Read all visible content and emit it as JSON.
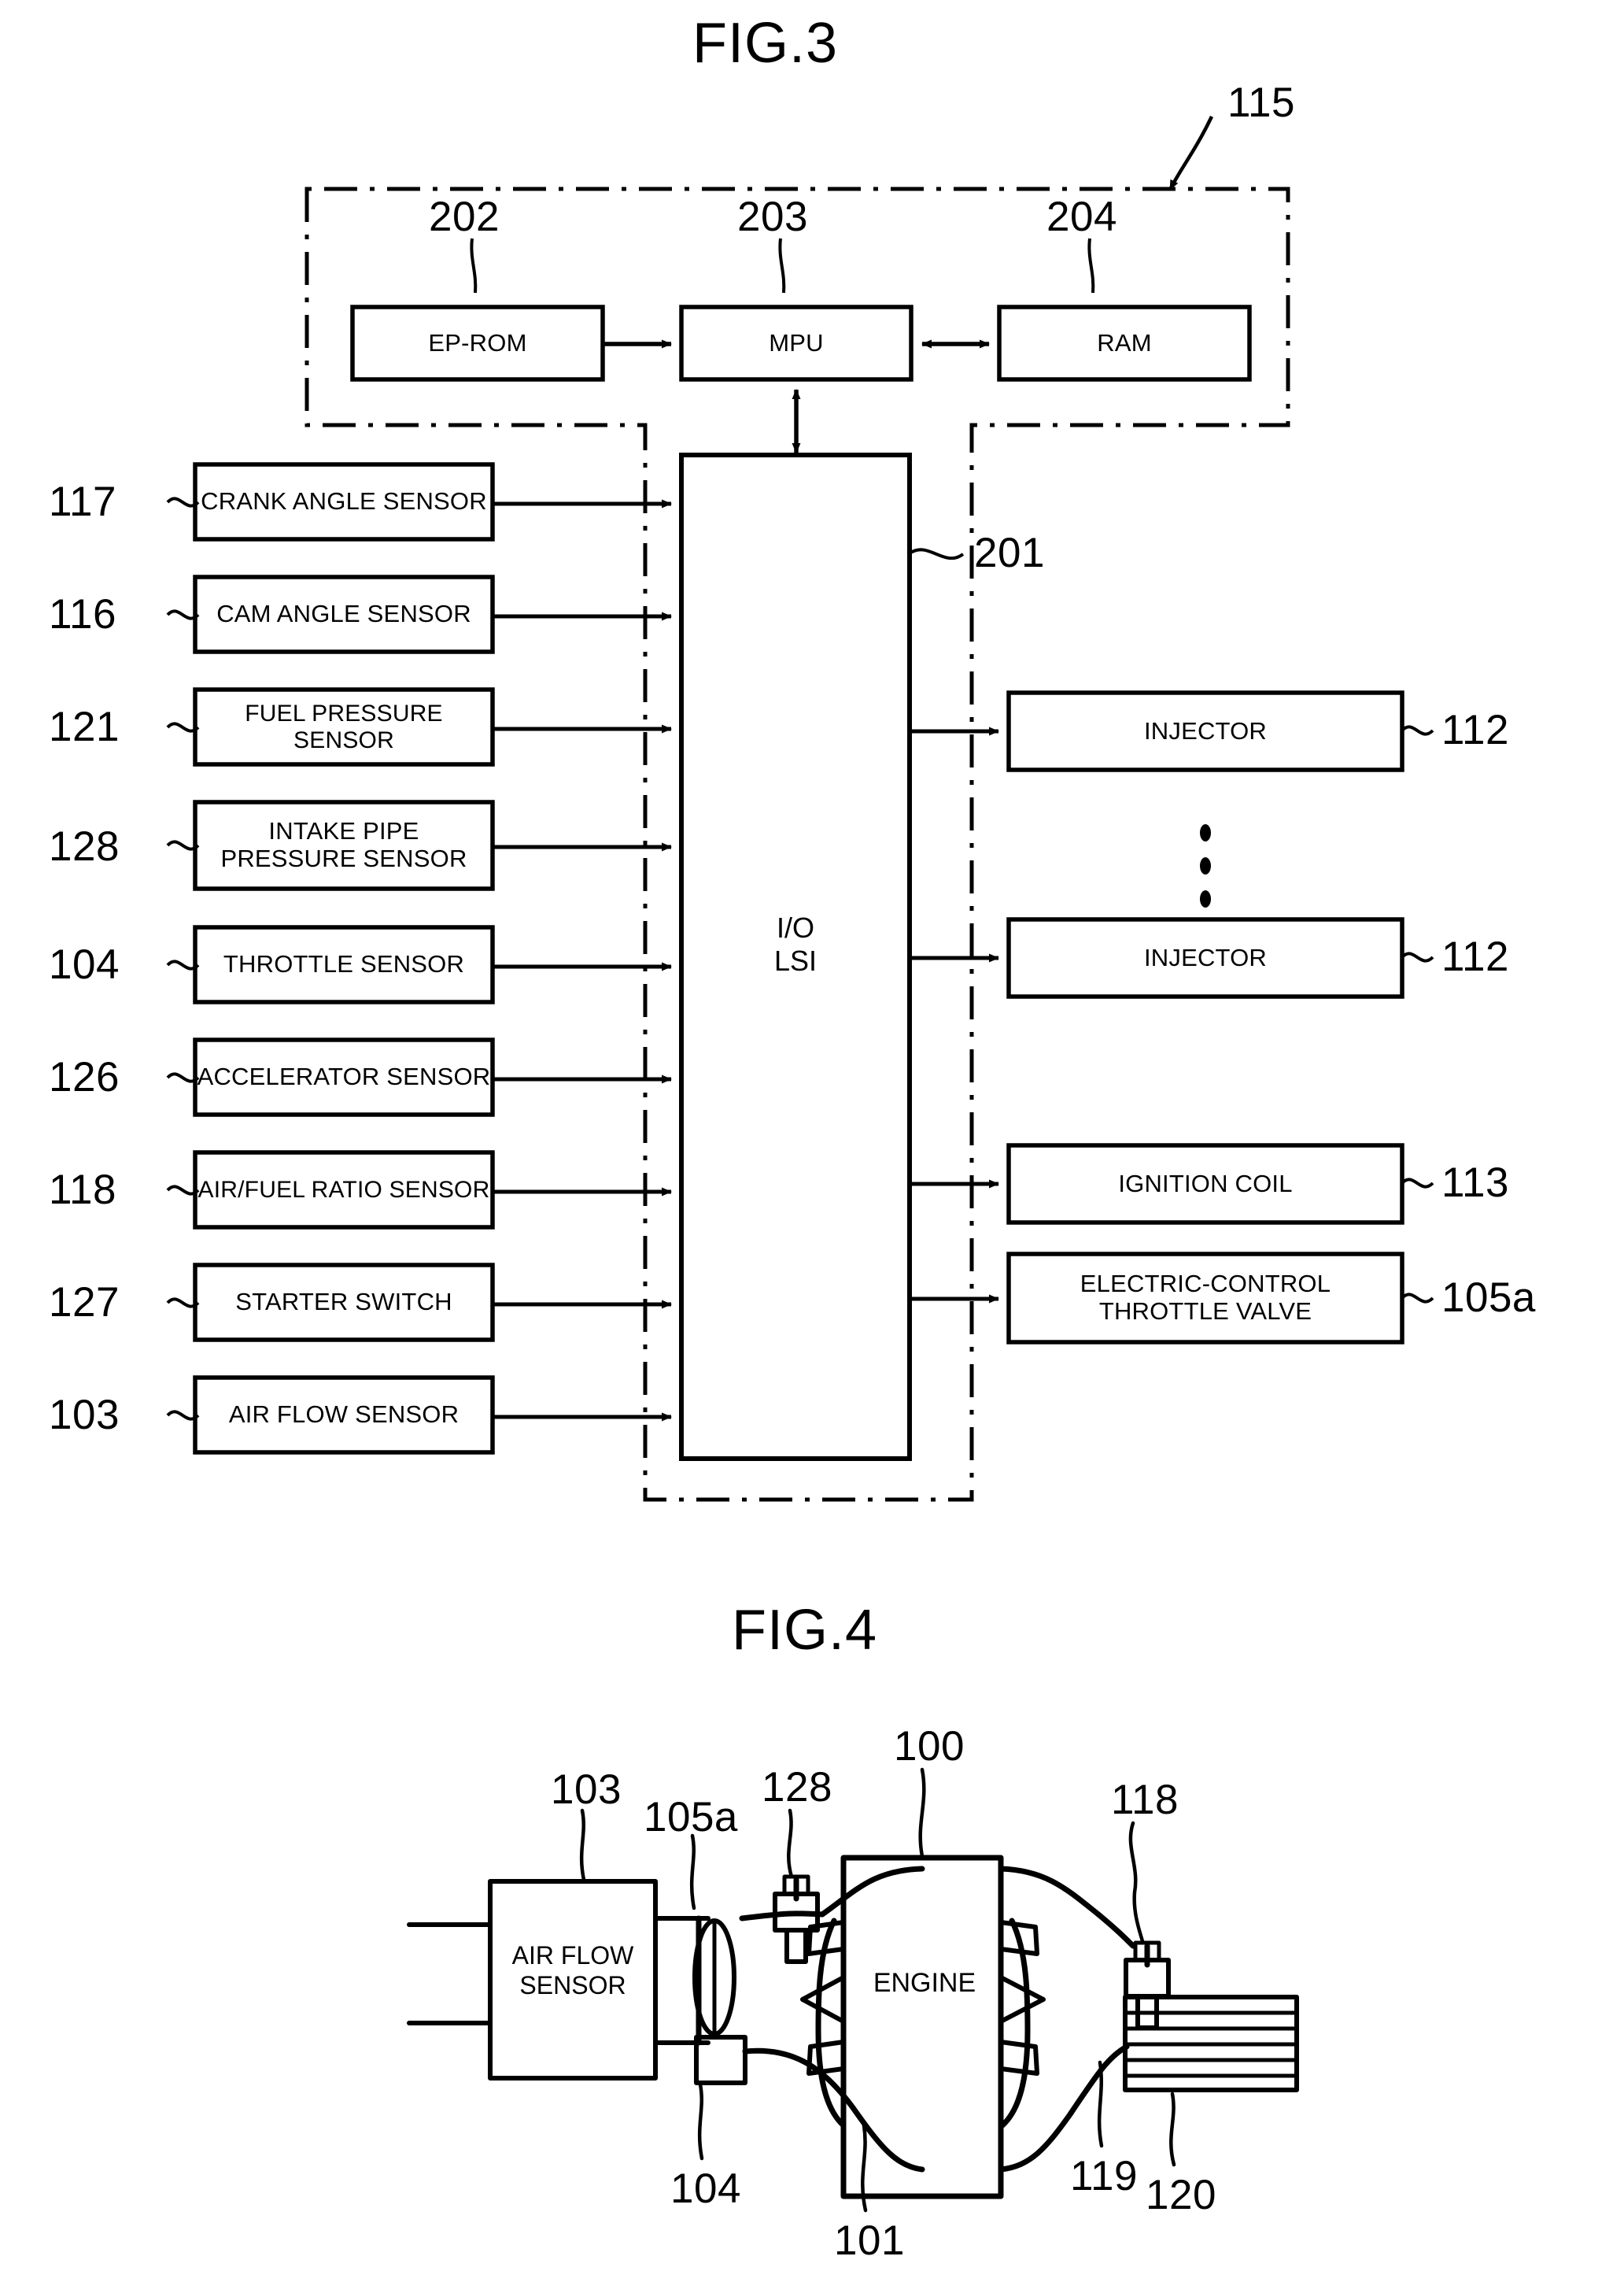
{
  "figures": [
    {
      "title": "FIG.3",
      "ecu_ref": "115",
      "internal_refs": [
        "202",
        "203",
        "204",
        "201"
      ],
      "ecu_modules": [
        {
          "ref": "202",
          "label": "EP-ROM"
        },
        {
          "ref": "203",
          "label": "MPU"
        },
        {
          "ref": "204",
          "label": "RAM"
        }
      ],
      "io_block": {
        "ref": "201",
        "label": "I/O\nLSI"
      },
      "inputs": [
        {
          "ref": "117",
          "label": "CRANK ANGLE SENSOR"
        },
        {
          "ref": "116",
          "label": "CAM ANGLE SENSOR"
        },
        {
          "ref": "121",
          "label": "FUEL PRESSURE SENSOR"
        },
        {
          "ref": "128",
          "label": "INTAKE PIPE\nPRESSURE SENSOR"
        },
        {
          "ref": "104",
          "label": "THROTTLE SENSOR"
        },
        {
          "ref": "126",
          "label": "ACCELERATOR SENSOR"
        },
        {
          "ref": "118",
          "label": "AIR/FUEL RATIO SENSOR"
        },
        {
          "ref": "127",
          "label": "STARTER SWITCH"
        },
        {
          "ref": "103",
          "label": "AIR FLOW SENSOR"
        }
      ],
      "outputs": [
        {
          "ref": "112",
          "label": "INJECTOR"
        },
        {
          "ref": "112",
          "label": "INJECTOR"
        },
        {
          "ref": "113",
          "label": "IGNITION COIL"
        },
        {
          "ref": "105a",
          "label": "ELECTRIC-CONTROL\nTHROTTLE VALVE"
        }
      ],
      "ellipsis": "⋮"
    },
    {
      "title": "FIG.4",
      "air_flow_sensor_label": "AIR FLOW\nSENSOR",
      "engine_label": "ENGINE",
      "refs": [
        {
          "ref": "103",
          "target": "air-flow-sensor"
        },
        {
          "ref": "105a",
          "target": "throttle-valve"
        },
        {
          "ref": "128",
          "target": "intake-pipe-pressure-sensor"
        },
        {
          "ref": "100",
          "target": "engine"
        },
        {
          "ref": "118",
          "target": "air-fuel-ratio-sensor"
        },
        {
          "ref": "104",
          "target": "throttle-sensor"
        },
        {
          "ref": "101",
          "target": "intake-manifold"
        },
        {
          "ref": "119",
          "target": "exhaust-pipe"
        },
        {
          "ref": "120",
          "target": "catalyst"
        }
      ]
    }
  ],
  "colors": {
    "ink": "#000000",
    "paper": "#ffffff"
  }
}
